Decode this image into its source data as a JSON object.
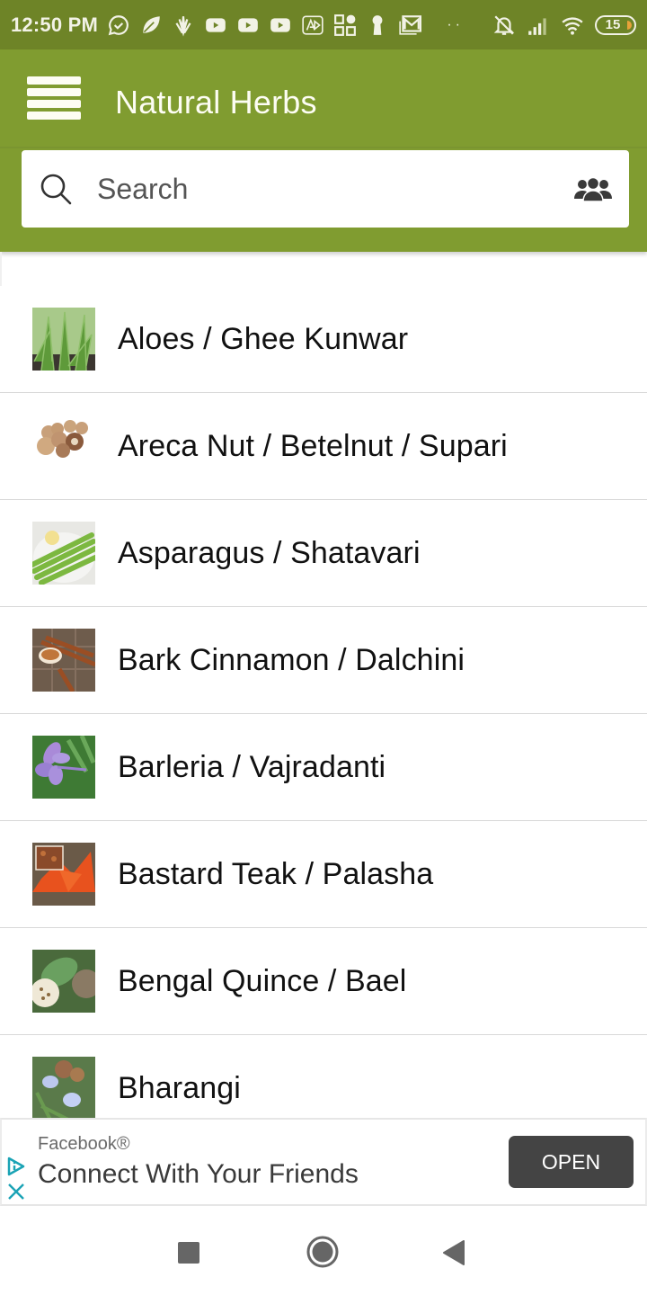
{
  "status_bar": {
    "time": "12:50 PM",
    "left_icons": [
      "whatsapp-icon",
      "leaf-icon",
      "plant-icon",
      "youtube-icon",
      "youtube-icon",
      "youtube-icon",
      "alt-app-icon",
      "apps-grid-icon",
      "keyhole-icon",
      "gmail-icon"
    ],
    "overflow_dots": "··",
    "right_icons": [
      "bell-muted-icon",
      "signal-icon",
      "wifi-icon"
    ],
    "battery_level": "15"
  },
  "app_bar": {
    "title": "Natural Herbs",
    "menu_icon": "hamburger-menu-icon",
    "search": {
      "placeholder": "Search",
      "value": "",
      "leading_icon": "search-icon",
      "trailing_icon": "people-group-icon"
    }
  },
  "herbs": [
    {
      "label": "Aloes / Ghee Kunwar",
      "thumbnail": "aloe-vera"
    },
    {
      "label": "Areca Nut / Betelnut / Supari",
      "thumbnail": "areca-nuts"
    },
    {
      "label": "Asparagus / Shatavari",
      "thumbnail": "asparagus"
    },
    {
      "label": "Bark Cinnamon / Dalchini",
      "thumbnail": "cinnamon"
    },
    {
      "label": "Barleria / Vajradanti",
      "thumbnail": "purple-flower"
    },
    {
      "label": "Bastard Teak / Palasha",
      "thumbnail": "orange-flowers"
    },
    {
      "label": "Bengal Quince / Bael",
      "thumbnail": "bael-fruit"
    },
    {
      "label": "Bharangi",
      "thumbnail": "blue-flowers"
    }
  ],
  "ad": {
    "advertiser": "Facebook®",
    "headline": "Connect With Your Friends",
    "cta": "OPEN",
    "accent_color": "#1aa3b5"
  },
  "nav_bar": {
    "buttons": [
      "recents",
      "home",
      "back"
    ]
  },
  "colors": {
    "status_bar": "#6e8427",
    "app_bar": "#809c30",
    "cta_button": "#444444"
  }
}
